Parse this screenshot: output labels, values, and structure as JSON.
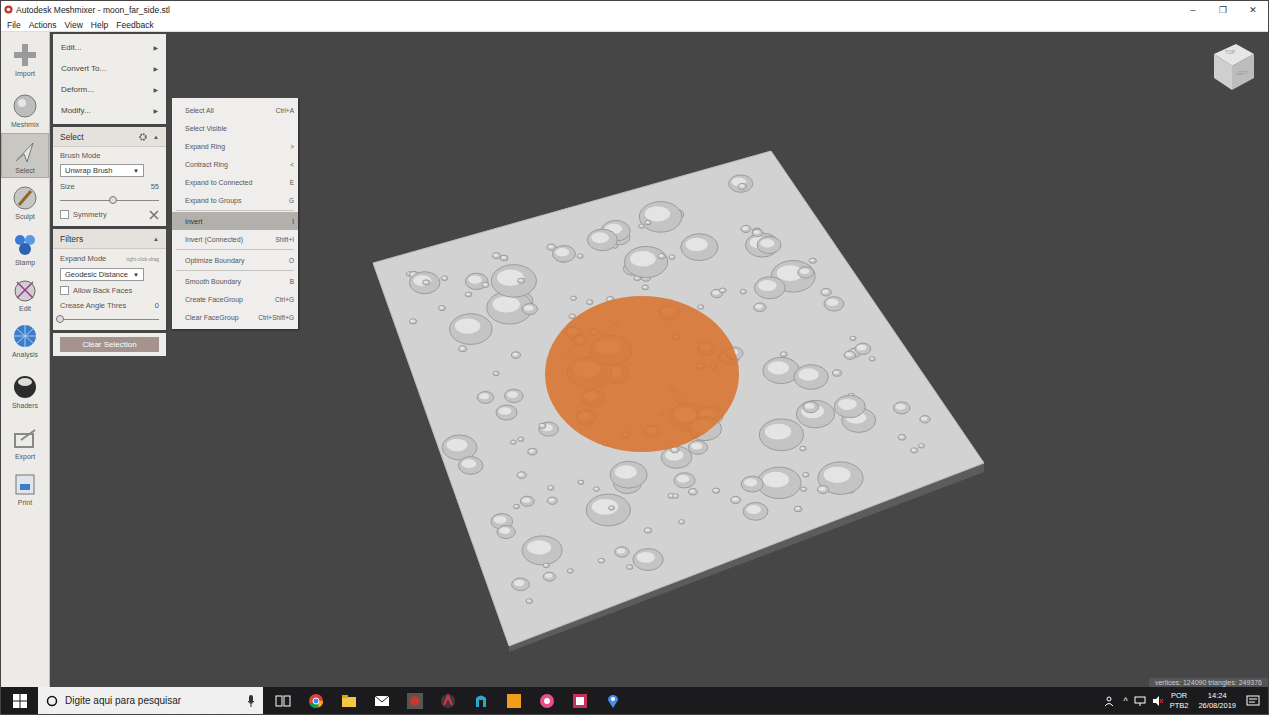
{
  "window": {
    "title": "Autodesk Meshmixer - moon_far_side.stl",
    "controls": [
      "–",
      "❐",
      "✕"
    ]
  },
  "menu_bar": [
    "File",
    "Actions",
    "View",
    "Help",
    "Feedback"
  ],
  "toolbar": [
    {
      "label": "Import",
      "selected": false
    },
    {
      "label": "Meshmix",
      "selected": false
    },
    {
      "label": "Select",
      "selected": true
    },
    {
      "label": "Sculpt",
      "selected": false
    },
    {
      "label": "Stamp",
      "selected": false
    },
    {
      "label": "Edit",
      "selected": false
    },
    {
      "label": "Analysis",
      "selected": false
    },
    {
      "label": "Shaders",
      "selected": false
    },
    {
      "label": "Export",
      "selected": false
    },
    {
      "label": "Print",
      "selected": false
    }
  ],
  "panel": {
    "menu": [
      {
        "label": "Edit...",
        "arrow": "▶"
      },
      {
        "label": "Convert To...",
        "arrow": "▶"
      },
      {
        "label": "Deform...",
        "arrow": "▶"
      },
      {
        "label": "Modify...",
        "arrow": "▶"
      }
    ],
    "select": {
      "title": "Select",
      "collapse": "▲",
      "brush_mode_label": "Brush Mode",
      "brush_mode": "Unwrap Brush",
      "dropdown_arrow": "▼",
      "size_label": "Size",
      "size_value": "55",
      "size_level": 0.54,
      "symmetry_label": "Symmetry",
      "symmetry_checked": false
    },
    "filters": {
      "title": "Filters",
      "collapse": "▲",
      "expand_mode_label": "Expand Mode",
      "expand_mode_hint": "right-click-drag",
      "expand_mode": "Geodesic Distance",
      "dropdown_arrow": "▼",
      "allow_back_faces_label": "Allow Back Faces",
      "allow_back_faces_checked": false,
      "crease_label": "Crease Angle Thres",
      "crease_value": "0",
      "crease_level": 0.0
    },
    "clear_button": "Clear Selection"
  },
  "submenu": [
    {
      "label": "Select All",
      "shortcut": "Ctrl+A",
      "selected": false,
      "separator_after": false
    },
    {
      "label": "Select Visible",
      "shortcut": "",
      "selected": false,
      "separator_after": false
    },
    {
      "label": "Expand Ring",
      "shortcut": ">",
      "selected": false,
      "separator_after": false
    },
    {
      "label": "Contract Ring",
      "shortcut": "<",
      "selected": false,
      "separator_after": false
    },
    {
      "label": "Expand to Connected",
      "shortcut": "E",
      "selected": false,
      "separator_after": false
    },
    {
      "label": "Expand to Groups",
      "shortcut": "G",
      "selected": false,
      "separator_after": true
    },
    {
      "label": "Invert",
      "shortcut": "I",
      "selected": true,
      "separator_after": false
    },
    {
      "label": "Invert (Connected)",
      "shortcut": "Shift+I",
      "selected": false,
      "separator_after": true
    },
    {
      "label": "Optimize Boundary",
      "shortcut": "O",
      "selected": false,
      "separator_after": true
    },
    {
      "label": "Smooth Boundary",
      "shortcut": "B",
      "selected": false,
      "separator_after": false
    },
    {
      "label": "Create FaceGroup",
      "shortcut": "Ctrl+G",
      "selected": false,
      "separator_after": false
    },
    {
      "label": "Clear FaceGroup",
      "shortcut": "Ctrl+Shift+G",
      "selected": false,
      "separator_after": false
    }
  ],
  "viewcube": {
    "faces": [
      "TOP",
      "LEFT"
    ]
  },
  "status": "vertices: 124090 triangles: 249376",
  "taskbar": {
    "search_placeholder": "Digite aqui para pesquisar",
    "tray_chevron": "^",
    "language": "POR",
    "layout": "PTB2",
    "time": "14:24",
    "date": "26/08/2019"
  }
}
